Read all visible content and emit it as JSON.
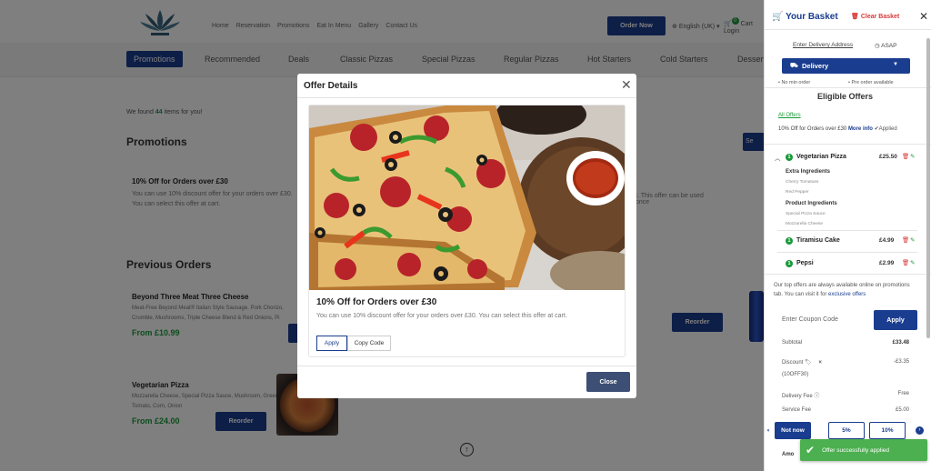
{
  "header": {
    "nav_items": [
      "Home",
      "Reservation",
      "Promotions",
      "Eat In Menu",
      "Gallery",
      "Contact Us"
    ],
    "order_now": "Order Now",
    "language": "English (UK)",
    "cart_count": "0",
    "cart_label": "Cart",
    "login_label": "Login"
  },
  "categories": [
    "Promotions",
    "Recommended",
    "Deals",
    "Classic Pizzas",
    "Special Pizzas",
    "Regular Pizzas",
    "Hot Starters",
    "Cold Starters",
    "Desserts"
  ],
  "main": {
    "found_prefix": "We found",
    "found_count": "44",
    "found_suffix": "items for you!",
    "promotions_title": "Promotions",
    "promo_title": "10% Off for Orders over £30",
    "promo_desc": "You can use 10% discount offer for your orders over £30. You can select this offer at cart.",
    "promo_desc_tail": "t. This offer can be used once",
    "promo_select": "Se",
    "previous_title": "Previous Orders",
    "previous_orders": [
      {
        "title": "Beyond Three Meat Three Cheese",
        "desc": "Meat-Free Beyond Meat® Italian Style Sausage, Pork Chorizo, Crumble, Mushrooms, Triple Cheese Blend & Red Onions, Pi",
        "price": "From £10.99",
        "reorder": "Reorder"
      },
      {
        "title": "Vegetarian Pizza",
        "desc": "Mozzarella Cheese, Special Pizza Sauce, Mushroom, Green Pepper, Tomato, Corn, Onion",
        "price": "From £24.00",
        "reorder": "Reorder"
      }
    ]
  },
  "modal": {
    "title": "Offer Details",
    "offer_title": "10% Off for Orders over £30",
    "offer_desc": "You can use 10% discount offer for your orders over £30. You can select this offer at cart.",
    "apply": "Apply",
    "copy_code": "Copy Code",
    "close": "Close"
  },
  "basket": {
    "title": "Your Basket",
    "clear": "Clear Basket",
    "enter_address": "Enter Delivery Address",
    "asap": "ASAP",
    "delivery": "Delivery",
    "no_min": "• No min order",
    "preorder": "• Pre order available",
    "eligible_title": "Eligible Offers",
    "all_offers": "All Offers",
    "applied_offer": "10% Off for Orders over £30",
    "more_info": "More info",
    "applied": "Applied",
    "items": [
      {
        "qty": "1",
        "name": "Vegetarian Pizza",
        "price": "£25.50"
      },
      {
        "qty": "1",
        "name": "Tiramisu Cake",
        "price": "£4.99"
      },
      {
        "qty": "1",
        "name": "Pepsi",
        "price": "£2.99"
      }
    ],
    "extra_label": "Extra Ingredients",
    "extras": [
      "Cherry Tomatoes",
      "Red Pepper"
    ],
    "product_label": "Product Ingredients",
    "product_ingredients": [
      "Special Pizza Sauce",
      "Mozzarella Cheese"
    ],
    "info_text": "Our top offers are always available online on promotions tab. You can visit it for",
    "exclusive": "exclusive offers",
    "coupon_placeholder": "Enter Coupon Code",
    "coupon_apply": "Apply",
    "subtotal_label": "Subtotal",
    "subtotal": "£33.48",
    "discount_label": "Discount",
    "discount_code": "(10OFF30)",
    "discount": "-£3.35",
    "delivery_fee_label": "Delivery Fee",
    "delivery_fee": "Free",
    "service_fee_label": "Service Fee",
    "service_fee": "£5.00",
    "tips": [
      "Not now",
      "5%",
      "10%"
    ],
    "amount_label": "Amo"
  },
  "toast": {
    "message": "Offer successfully applied"
  },
  "colors": {
    "primary": "#1a3d8f",
    "success": "#1a9a3a",
    "danger": "#d83b3b",
    "toast": "#4caf50"
  }
}
